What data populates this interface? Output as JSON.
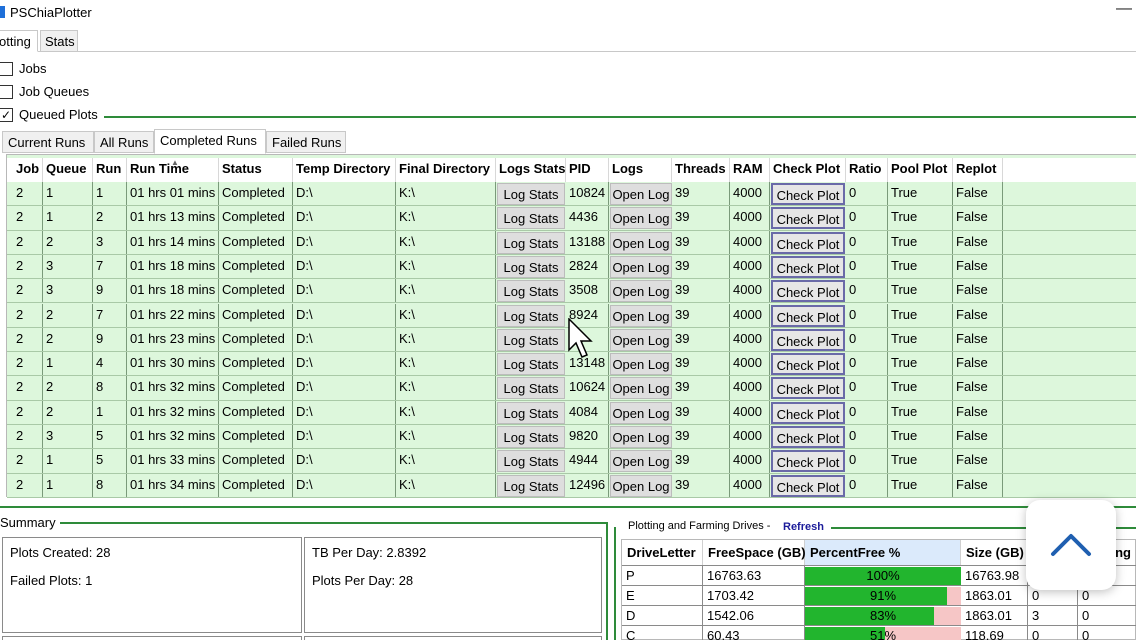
{
  "window": {
    "title": "PSChiaPlotter",
    "minimize": "—"
  },
  "main_tabs": [
    "otting",
    "Stats"
  ],
  "expanders": [
    {
      "label": "Jobs",
      "checked": false
    },
    {
      "label": "Job Queues",
      "checked": false
    },
    {
      "label": "Queued Plots",
      "checked": true
    }
  ],
  "run_tabs": [
    "Current Runs",
    "All Runs",
    "Completed Runs",
    "Failed Runs"
  ],
  "grid": {
    "columns": [
      "Job",
      "Queue",
      "Run",
      "Run Time",
      "Status",
      "Temp Directory",
      "Final Directory",
      "Logs Stats",
      "PID",
      "Logs",
      "Threads",
      "RAM",
      "Check Plot",
      "Ratio",
      "Pool Plot",
      "Replot"
    ],
    "log_stats_label": "Log Stats",
    "open_log_label": "Open Log",
    "check_plot_label": "Check Plot",
    "rows": [
      [
        "2",
        "1",
        "1",
        "01 hrs 01 mins",
        "Completed",
        "D:\\",
        "K:\\",
        "10824",
        "39",
        "4000",
        "0",
        "True",
        "False"
      ],
      [
        "2",
        "1",
        "2",
        "01 hrs 13 mins",
        "Completed",
        "D:\\",
        "K:\\",
        "4436",
        "39",
        "4000",
        "0",
        "True",
        "False"
      ],
      [
        "2",
        "2",
        "3",
        "01 hrs 14 mins",
        "Completed",
        "D:\\",
        "K:\\",
        "13188",
        "39",
        "4000",
        "0",
        "True",
        "False"
      ],
      [
        "2",
        "3",
        "7",
        "01 hrs 18 mins",
        "Completed",
        "D:\\",
        "K:\\",
        "2824",
        "39",
        "4000",
        "0",
        "True",
        "False"
      ],
      [
        "2",
        "3",
        "9",
        "01 hrs 18 mins",
        "Completed",
        "D:\\",
        "K:\\",
        "3508",
        "39",
        "4000",
        "0",
        "True",
        "False"
      ],
      [
        "2",
        "2",
        "7",
        "01 hrs 22 mins",
        "Completed",
        "D:\\",
        "K:\\",
        "8924",
        "39",
        "4000",
        "0",
        "True",
        "False"
      ],
      [
        "2",
        "2",
        "9",
        "01 hrs 23 mins",
        "Completed",
        "D:\\",
        "K:\\",
        "56",
        "39",
        "4000",
        "0",
        "True",
        "False"
      ],
      [
        "2",
        "1",
        "4",
        "01 hrs 30 mins",
        "Completed",
        "D:\\",
        "K:\\",
        "13148",
        "39",
        "4000",
        "0",
        "True",
        "False"
      ],
      [
        "2",
        "2",
        "8",
        "01 hrs 32 mins",
        "Completed",
        "D:\\",
        "K:\\",
        "10624",
        "39",
        "4000",
        "0",
        "True",
        "False"
      ],
      [
        "2",
        "2",
        "1",
        "01 hrs 32 mins",
        "Completed",
        "D:\\",
        "K:\\",
        "4084",
        "39",
        "4000",
        "0",
        "True",
        "False"
      ],
      [
        "2",
        "3",
        "5",
        "01 hrs 32 mins",
        "Completed",
        "D:\\",
        "K:\\",
        "9820",
        "39",
        "4000",
        "0",
        "True",
        "False"
      ],
      [
        "2",
        "1",
        "5",
        "01 hrs 33 mins",
        "Completed",
        "D:\\",
        "K:\\",
        "4944",
        "39",
        "4000",
        "0",
        "True",
        "False"
      ],
      [
        "2",
        "1",
        "8",
        "01 hrs 34 mins",
        "Completed",
        "D:\\",
        "K:\\",
        "12496",
        "39",
        "4000",
        "0",
        "True",
        "False"
      ]
    ]
  },
  "summary": {
    "title": "Summary",
    "plots_created": "Plots Created:  28",
    "failed_plots": "Failed Plots:  1",
    "tb_per_day": "TB Per Day: 2.8392",
    "plots_per_day": "Plots Per Day: 28"
  },
  "drives": {
    "title": "Plotting and Farming Drives -",
    "refresh": "Refresh",
    "columns": [
      "DriveLetter",
      "FreeSpace (GB)",
      "PercentFree %",
      "Size (GB)",
      "ing"
    ],
    "rows": [
      {
        "letter": "P",
        "free": "16763.63",
        "percent": 100,
        "percent_label": "100%",
        "size": "16763.98",
        "c5": "",
        "c6": ""
      },
      {
        "letter": "E",
        "free": "1703.42",
        "percent": 91,
        "percent_label": "91%",
        "size": "1863.01",
        "c5": "0",
        "c6": "0"
      },
      {
        "letter": "D",
        "free": "1542.06",
        "percent": 83,
        "percent_label": "83%",
        "size": "1863.01",
        "c5": "3",
        "c6": "0"
      },
      {
        "letter": "C",
        "free": "60.43",
        "percent": 51,
        "percent_label": "51%",
        "size": "118.69",
        "c5": "0",
        "c6": "0"
      }
    ]
  },
  "colors": {
    "row_bg": "#ddf7dc",
    "accent_green": "#2e8b3a",
    "bar_fill": "#22b52e",
    "bar_empty": "#f6c6c6",
    "refresh_link": "#1b1b9a"
  },
  "icons": {
    "scroll_top": "chevron-up-icon",
    "cursor": "mouse-pointer-icon"
  }
}
